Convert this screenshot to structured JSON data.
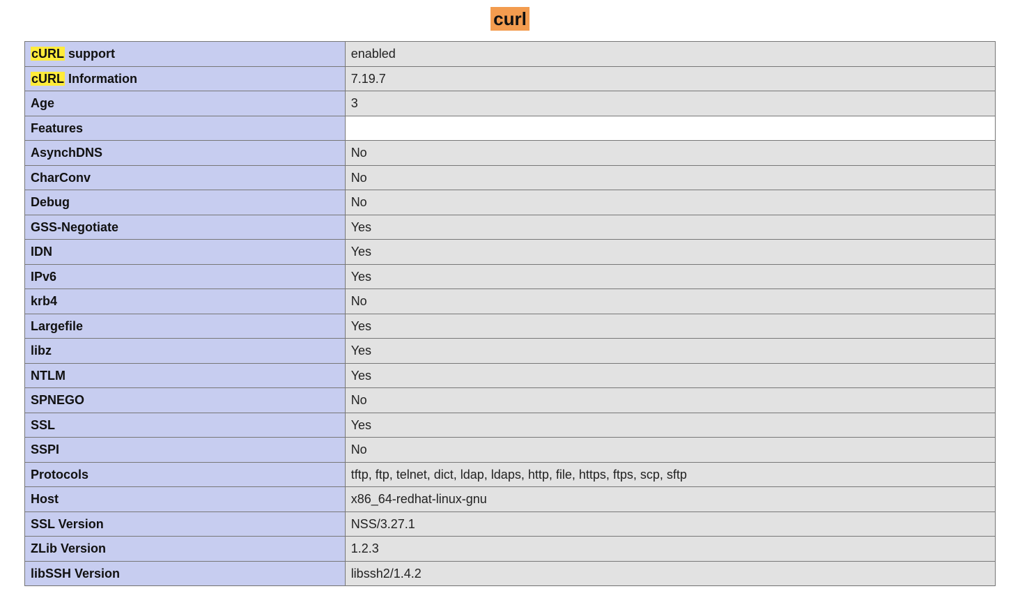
{
  "section": {
    "title": "curl",
    "highlight": "curl"
  },
  "rows": [
    {
      "label": "cURL support",
      "highlight_prefix": "cURL",
      "value": "enabled"
    },
    {
      "label": "cURL Information",
      "highlight_prefix": "cURL",
      "value": "7.19.7"
    },
    {
      "label": "Age",
      "value": "3"
    },
    {
      "label": "Features",
      "value": ""
    },
    {
      "label": "AsynchDNS",
      "value": "No"
    },
    {
      "label": "CharConv",
      "value": "No"
    },
    {
      "label": "Debug",
      "value": "No"
    },
    {
      "label": "GSS-Negotiate",
      "value": "Yes"
    },
    {
      "label": "IDN",
      "value": "Yes"
    },
    {
      "label": "IPv6",
      "value": "Yes"
    },
    {
      "label": "krb4",
      "value": "No"
    },
    {
      "label": "Largefile",
      "value": "Yes"
    },
    {
      "label": "libz",
      "value": "Yes"
    },
    {
      "label": "NTLM",
      "value": "Yes"
    },
    {
      "label": "SPNEGO",
      "value": "No"
    },
    {
      "label": "SSL",
      "value": "Yes"
    },
    {
      "label": "SSPI",
      "value": "No"
    },
    {
      "label": "Protocols",
      "value": "tftp, ftp, telnet, dict, ldap, ldaps, http, file, https, ftps, scp, sftp"
    },
    {
      "label": "Host",
      "value": "x86_64-redhat-linux-gnu"
    },
    {
      "label": "SSL Version",
      "value": "NSS/3.27.1"
    },
    {
      "label": "ZLib Version",
      "value": "1.2.3"
    },
    {
      "label": "libSSH Version",
      "value": "libssh2/1.4.2"
    }
  ]
}
